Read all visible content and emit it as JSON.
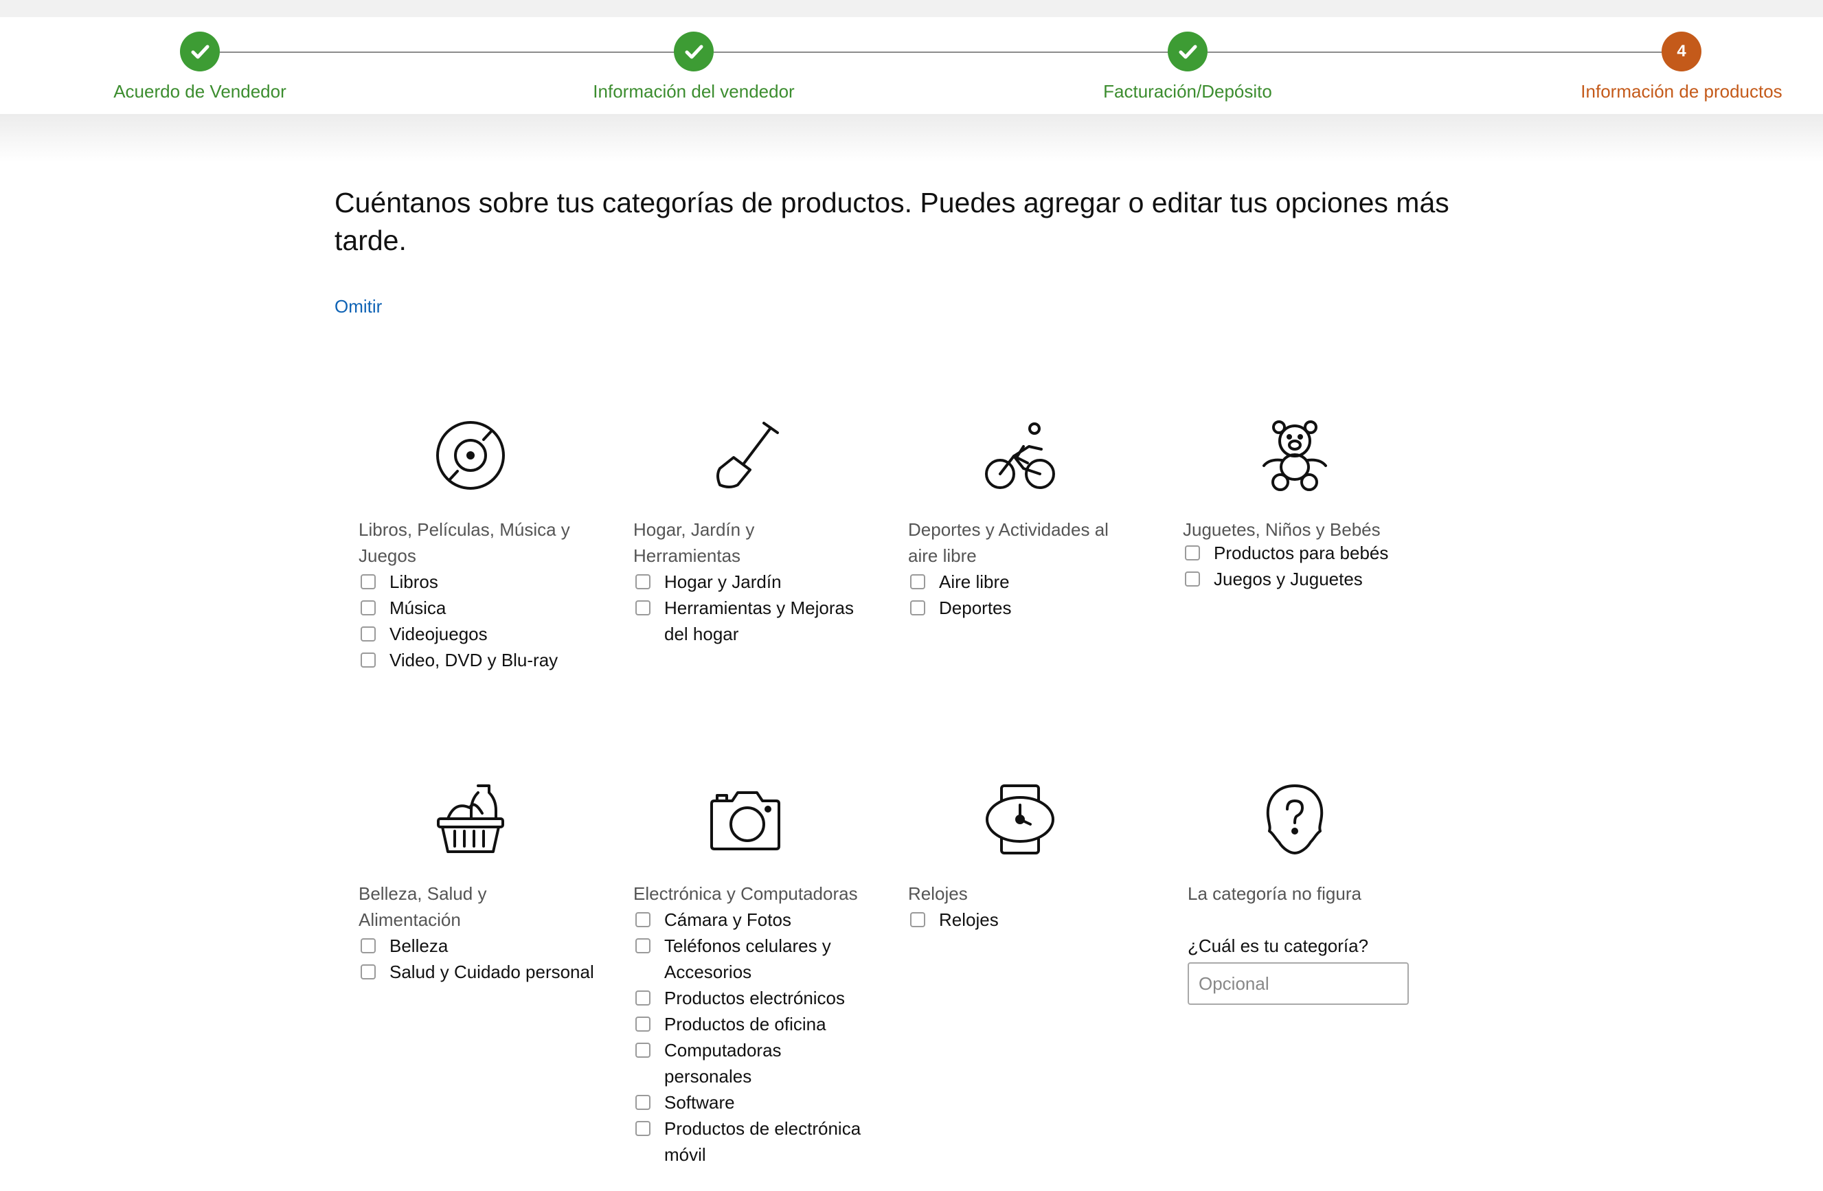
{
  "colors": {
    "done": "#3d9c34",
    "current": "#c45a1a",
    "link": "#0f63b5"
  },
  "stepper": {
    "steps": [
      {
        "label": "Acuerdo de Vendedor",
        "state": "done"
      },
      {
        "label": "Información del vendedor",
        "state": "done"
      },
      {
        "label": "Facturación/Depósito",
        "state": "done"
      },
      {
        "label": "Información de productos",
        "state": "current",
        "number": "4"
      }
    ]
  },
  "page": {
    "headline": "Cuéntanos sobre tus categorías de productos. Puedes agregar o editar tus opciones más tarde.",
    "skip_label": "Omitir"
  },
  "categories": [
    {
      "icon": "vinyl-record-icon",
      "title": "Libros, Películas, Música y Juegos",
      "options": [
        "Libros",
        "Música",
        "Videojuegos",
        "Video, DVD y Blu-ray"
      ]
    },
    {
      "icon": "shovel-icon",
      "title": "Hogar, Jardín y Herramientas",
      "options": [
        "Hogar y Jardín",
        "Herramientas y Mejoras del hogar"
      ]
    },
    {
      "icon": "cyclist-icon",
      "title": "Deportes y Actividades al aire libre",
      "options": [
        "Aire libre",
        "Deportes"
      ]
    },
    {
      "icon": "teddy-bear-icon",
      "title": "Juguetes, Niños y Bebés",
      "options": [
        "Productos para bebés",
        "Juegos y Juguetes"
      ]
    },
    {
      "icon": "grocery-basket-icon",
      "title": "Belleza, Salud y Alimentación",
      "options": [
        "Belleza",
        "Salud y Cuidado personal"
      ]
    },
    {
      "icon": "camera-icon",
      "title": "Electrónica y Computadoras",
      "options": [
        "Cámara y Fotos",
        "Teléfonos celulares y Accesorios",
        "Productos electrónicos",
        "Productos de oficina",
        "Computadoras personales",
        "Software",
        "Productos de electrónica móvil"
      ]
    },
    {
      "icon": "wristwatch-icon",
      "title": "Relojes",
      "options": [
        "Relojes"
      ]
    }
  ],
  "other_category": {
    "icon": "question-head-icon",
    "label": "La categoría no figura",
    "question": "¿Cuál es tu categoría?",
    "placeholder": "Opcional",
    "value": ""
  }
}
